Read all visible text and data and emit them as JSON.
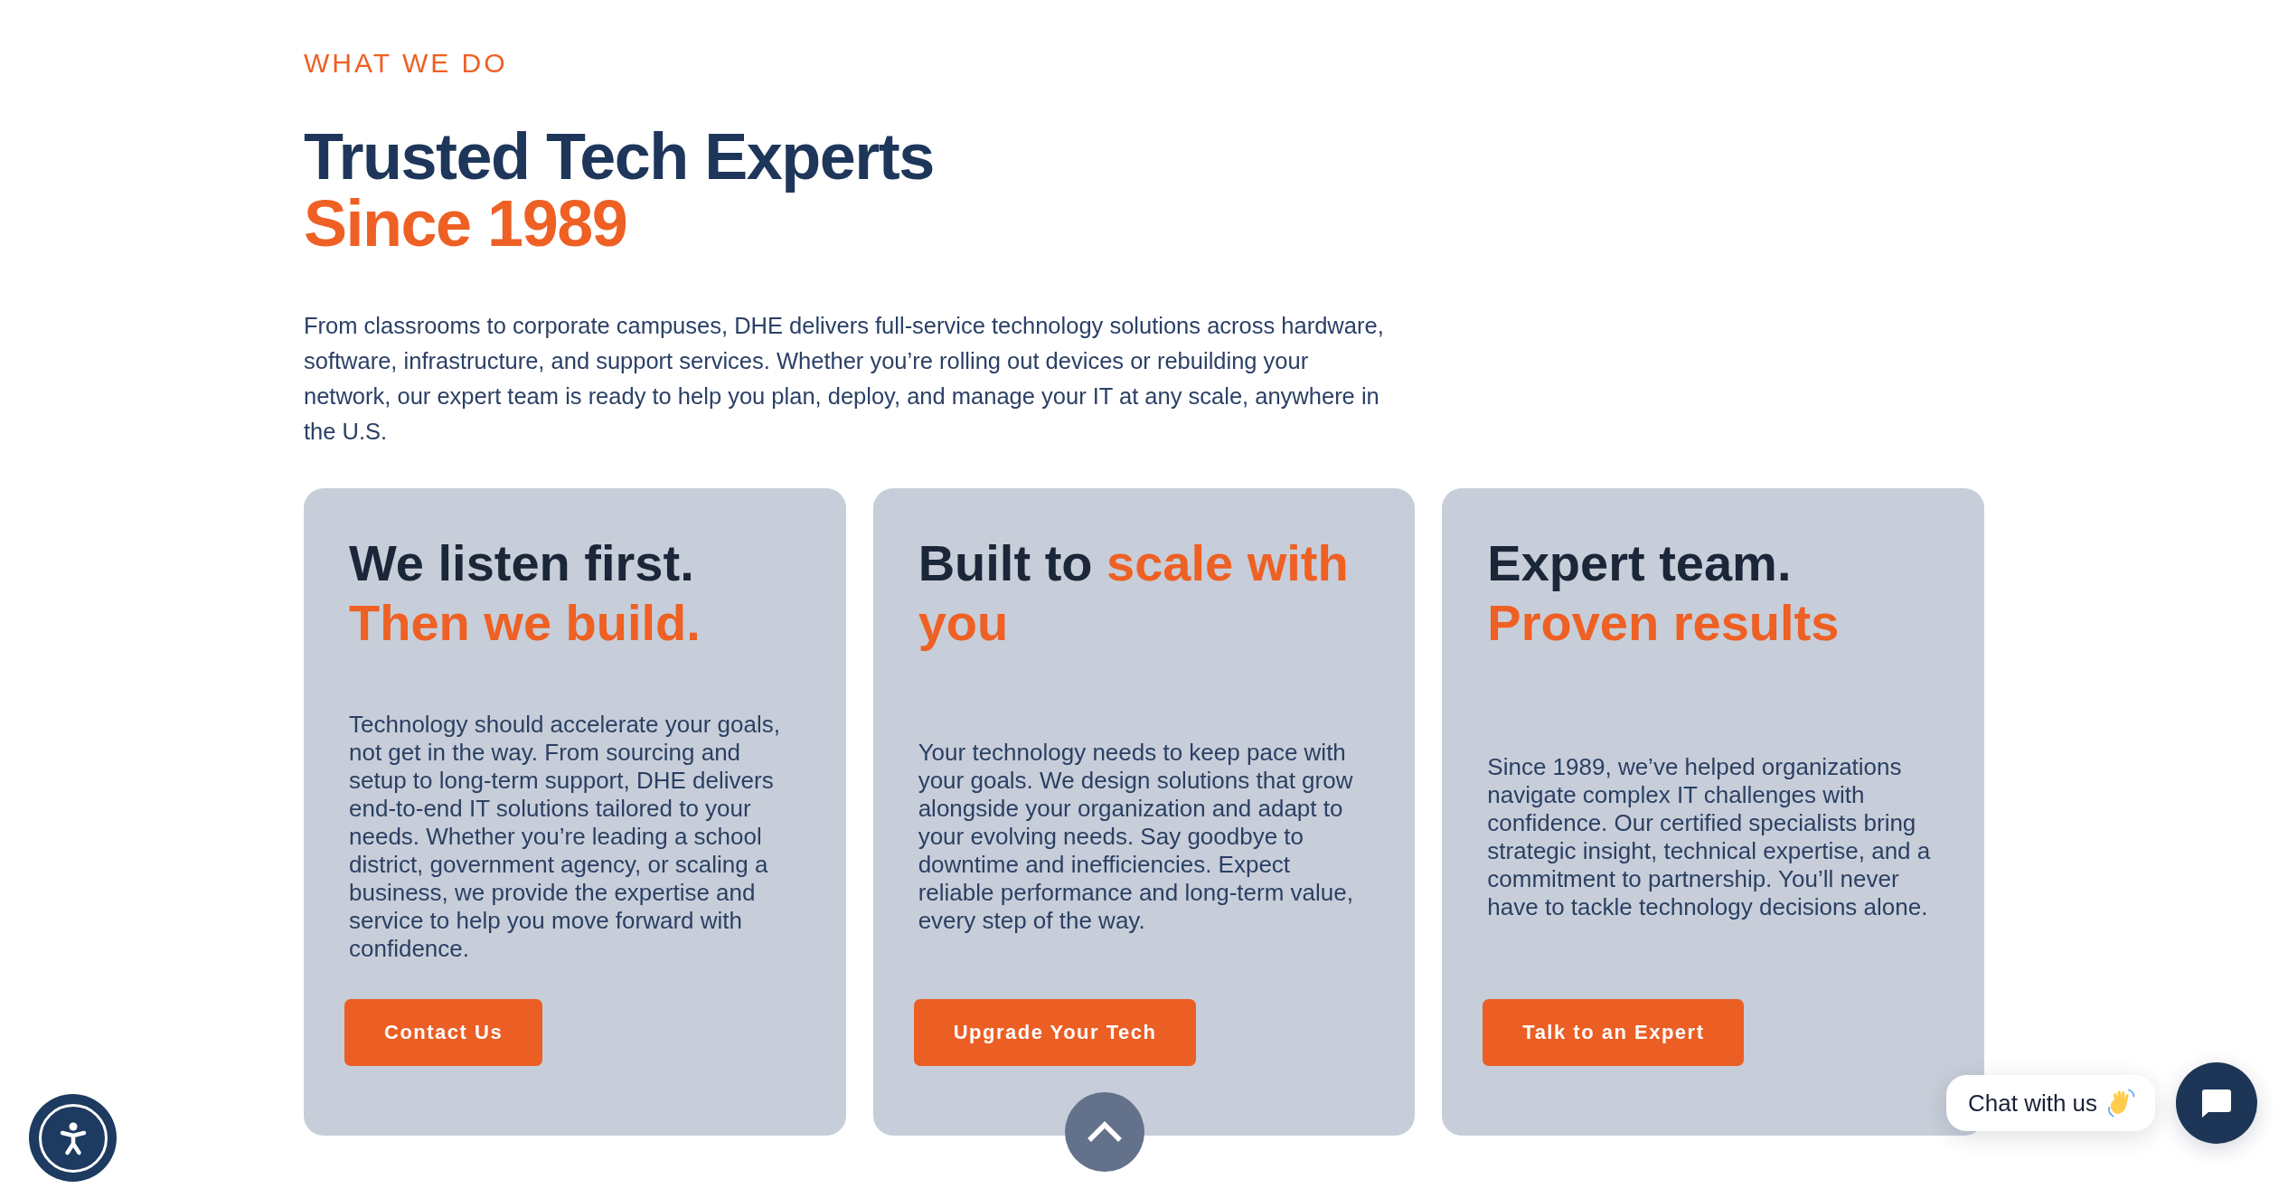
{
  "section": {
    "eyebrow": "WHAT WE DO",
    "title": {
      "lead": "Trusted Tech Experts",
      "accent": "Since 1989"
    },
    "intro": "From classrooms to corporate campuses, DHE delivers full-service technology solutions across hardware, software, infrastructure, and support services. Whether you’re rolling out devices or rebuilding your network, our expert team is ready to help you plan, deploy, and manage your IT at any scale, anywhere in the U.S."
  },
  "cards": [
    {
      "heading": {
        "lead": "We listen first.",
        "accent": "Then we build."
      },
      "body": "Technology should accelerate your goals, not get in the way. From sourcing and setup to long-term support, DHE delivers end-to-end IT solutions tailored to your needs. Whether you’re leading a school district, government agency, or scaling a business, we provide the expertise and service to help you move forward with confidence.",
      "button": "Contact Us"
    },
    {
      "heading": {
        "lead": "Built to",
        "accent": "scale with you"
      },
      "body": "Your technology needs to keep pace with your goals. We design solutions that grow alongside your organization and adapt to your evolving needs. Say goodbye to downtime and inefficiencies. Expect reliable performance and long-term value, every step of the way.",
      "button": "Upgrade Your Tech"
    },
    {
      "heading": {
        "lead": "Expert team.",
        "accent": "Proven results"
      },
      "body": "Since 1989, we’ve helped organizations navigate complex IT challenges with confidence. Our certified specialists bring strategic insight, technical expertise, and a commitment to partnership. You’ll never have to tackle technology decisions alone.",
      "button": "Talk to an Expert"
    }
  ],
  "chat_widget": {
    "prompt": "Chat with us"
  }
}
